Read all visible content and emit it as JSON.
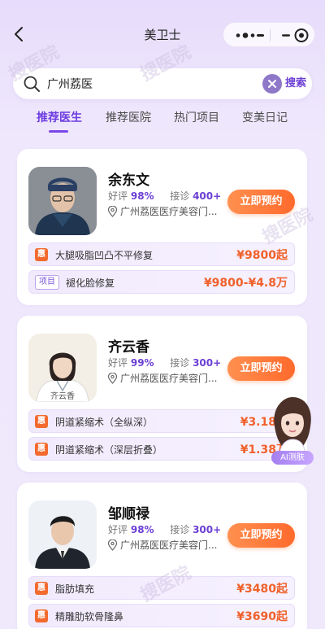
{
  "header": {
    "title": "美卫士"
  },
  "search": {
    "value": "广州荔医",
    "button_label": "搜索"
  },
  "tabs": [
    {
      "label": "推荐医生",
      "active": true
    },
    {
      "label": "推荐医院",
      "active": false
    },
    {
      "label": "热门项目",
      "active": false
    },
    {
      "label": "变美日记",
      "active": false
    }
  ],
  "book_label": "立即预约",
  "stat_labels": {
    "rating": "好评",
    "consult": "接诊"
  },
  "doctors": [
    {
      "name": "余东文",
      "rating": "98%",
      "consult": "400+",
      "clinic": "广州荔医医疗美容门...",
      "projects": [
        {
          "badge": "惠",
          "name": "大腿吸脂凹凸不平修复",
          "price": "¥9800起"
        },
        {
          "badge": "项目",
          "name": "褪化脸修复",
          "price": "¥9800-¥4.8万"
        }
      ]
    },
    {
      "name": "齐云香",
      "rating": "99%",
      "consult": "300+",
      "clinic": "广州荔医医疗美容门...",
      "photo_caption": "齐云香",
      "projects": [
        {
          "badge": "惠",
          "name": "阴道紧缩术（全纵深）",
          "price": "¥3.18万"
        },
        {
          "badge": "惠",
          "name": "阴道紧缩术（深层折叠）",
          "price": "¥1.38万"
        }
      ]
    },
    {
      "name": "邹顺禄",
      "rating": "98%",
      "consult": "300+",
      "clinic": "广州荔医医疗美容门...",
      "projects": [
        {
          "badge": "惠",
          "name": "脂肪填充",
          "price": "¥3480起"
        },
        {
          "badge": "惠",
          "name": "精雕肋软骨隆鼻",
          "price": "¥3690起"
        }
      ]
    }
  ],
  "ai_assistant": {
    "label": "AI测肤"
  },
  "watermark": "搜医院",
  "colors": {
    "accent": "#6b3fd4",
    "price": "#f0612b",
    "button": "#ff7a3a"
  }
}
